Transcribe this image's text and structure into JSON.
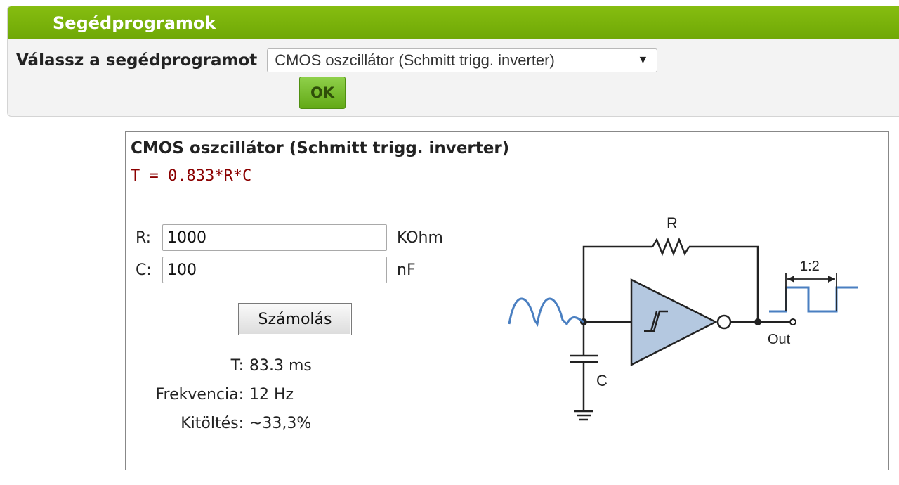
{
  "header": {
    "title": "Segédprogramok"
  },
  "selector": {
    "label": "Válassz a segédprogramot",
    "selected": "CMOS oszcillátor (Schmitt trigg. inverter)",
    "ok_label": "OK"
  },
  "calculator": {
    "title": "CMOS oszcillátor (Schmitt trigg. inverter)",
    "formula": "T = 0.833*R*C",
    "r_label": "R:",
    "r_value": "1000",
    "r_unit": "KOhm",
    "c_label": "C:",
    "c_value": "100",
    "c_unit": "nF",
    "button_label": "Számolás",
    "results": [
      {
        "label": "T:",
        "value": "83.3 ms"
      },
      {
        "label": "Frekvencia:",
        "value": "12 Hz"
      },
      {
        "label": "Kitöltés:",
        "value": "~33,3%"
      }
    ]
  },
  "diagram": {
    "r_text": "R",
    "c_text": "C",
    "out_text": "Out",
    "ratio_text": "1:2",
    "wire_color": "#222222",
    "signal_color": "#4a7fc1",
    "buffer_fill": "#b4c8e0"
  }
}
